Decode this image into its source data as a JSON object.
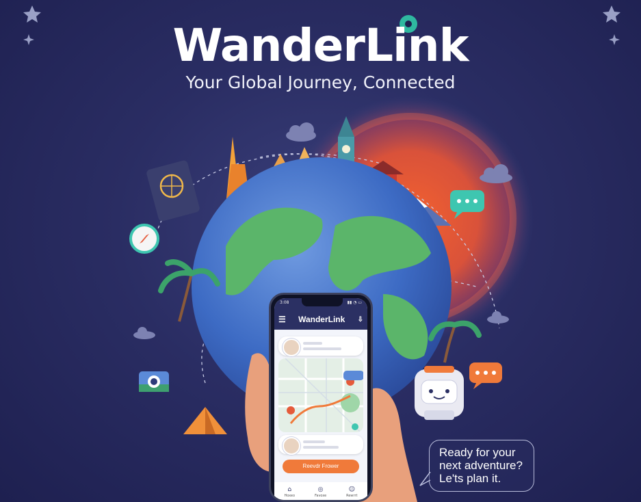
{
  "brand": {
    "title": "WanderLink",
    "tagline": "Your Global Journey, Connected"
  },
  "phone": {
    "status_time": "3:08",
    "app_title": "WanderLink",
    "cta_label": "Reevdr Frower",
    "tabs": [
      {
        "label": "Hoxeo",
        "icon": "home-icon"
      },
      {
        "label": "Favoxe",
        "icon": "globe-icon"
      },
      {
        "label": "Rewrrt",
        "icon": "person-icon"
      }
    ]
  },
  "speech_bubble": {
    "lines": [
      "Ready for your",
      "next adventure?",
      "Le'ts plan it."
    ]
  },
  "colors": {
    "background": "#2a2d63",
    "accent_orange": "#f07a3a",
    "accent_teal": "#3ec6b0",
    "globe_ocean": "#3d6bc4",
    "globe_land": "#5bb56a"
  }
}
